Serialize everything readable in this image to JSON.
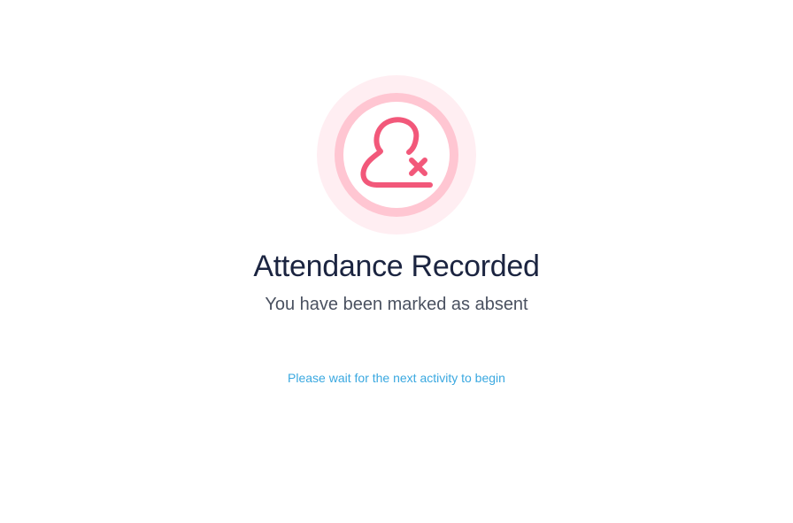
{
  "status": {
    "icon": "user-absent-icon",
    "title": "Attendance Recorded",
    "subtitle": "You have been marked as absent",
    "wait_message": "Please wait for the next activity to begin"
  },
  "colors": {
    "accent": "#f2587a",
    "ring_inner": "#ffc6d2",
    "halo_outer": "#ffeef2",
    "title_text": "#1b2440",
    "subtitle_text": "#4a5160",
    "info_text": "#3aa8e0"
  }
}
